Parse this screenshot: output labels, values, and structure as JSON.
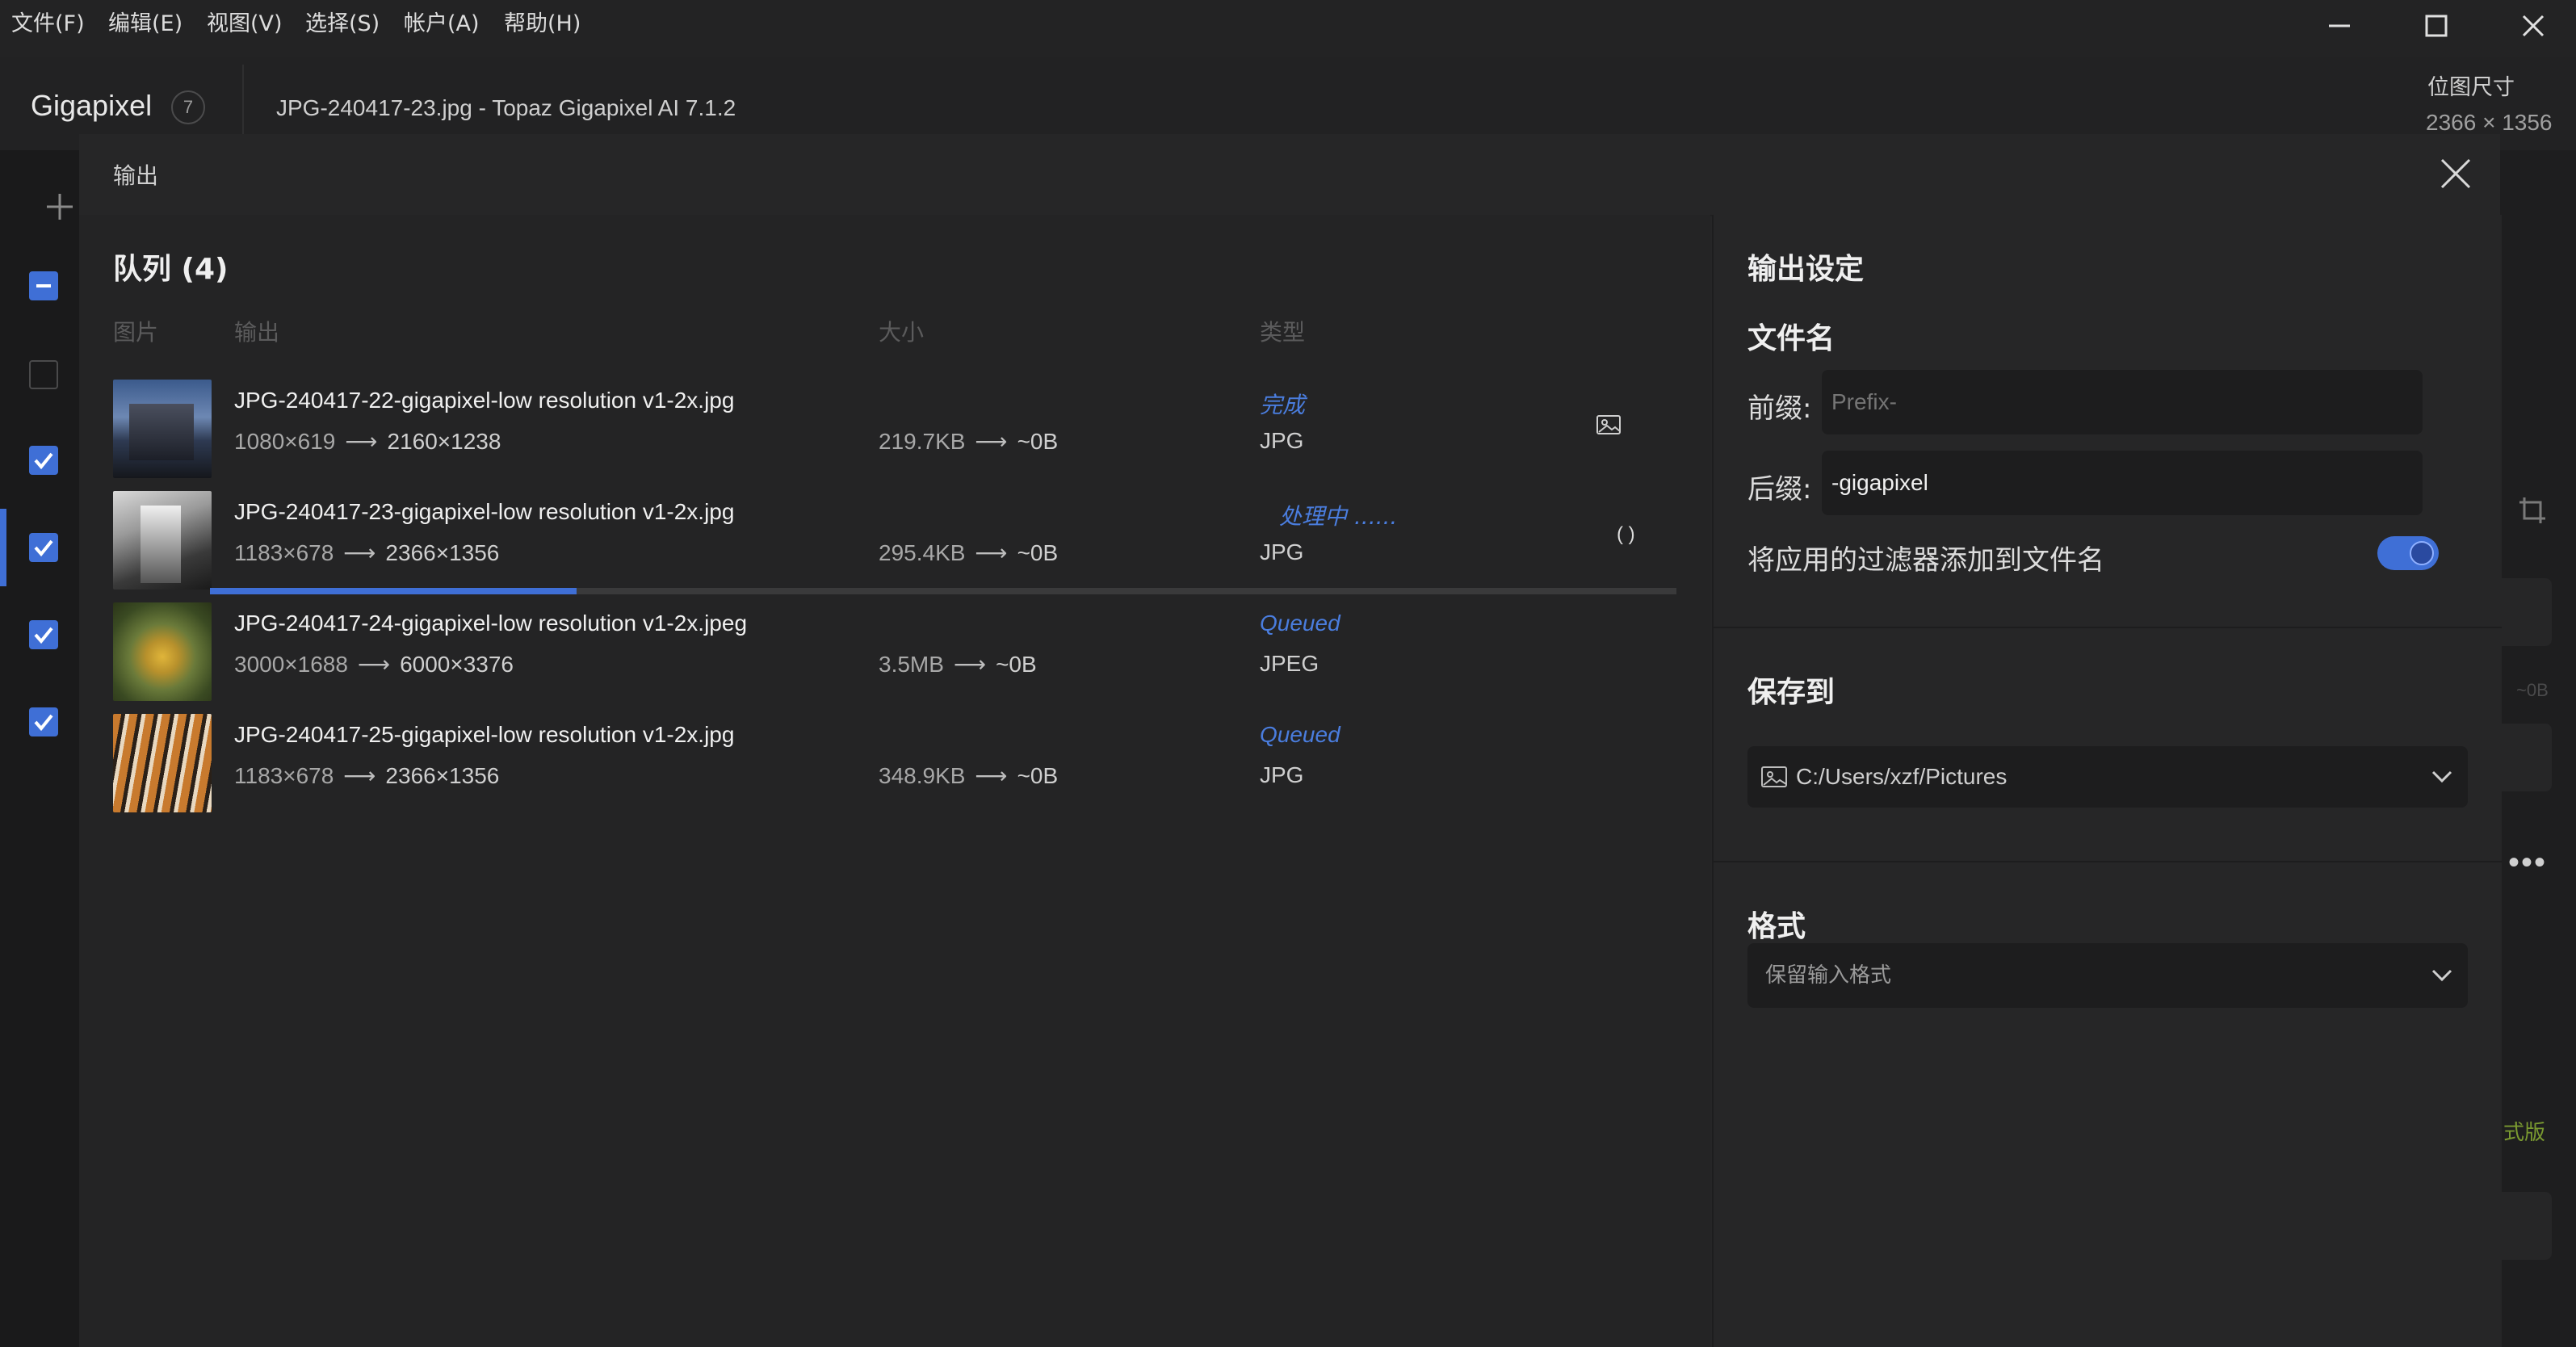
{
  "menu": {
    "items": [
      "文件(F)",
      "编辑(E)",
      "视图(V)",
      "选择(S)",
      "帐户(A)",
      "帮助(H)"
    ]
  },
  "app": {
    "name": "Gigapixel",
    "badge": "7",
    "window_title": "JPG-240417-23.jpg - Topaz Gigapixel AI 7.1.2",
    "bitmap_label": "位图尺寸",
    "bitmap_value": "2366 × 1356"
  },
  "dialog": {
    "title": "输出",
    "queue_title": "队列 (4)",
    "columns": [
      "图片",
      "输出",
      "大小",
      "类型"
    ],
    "rows": [
      {
        "filename": "JPG-240417-22-gigapixel-low resolution v1-2x.jpg",
        "dim_from": "1080×619",
        "dim_to": "2160×1238",
        "size_from": "219.7KB",
        "size_to": "~0B",
        "status": "完成",
        "type": "JPG",
        "action_icon": "folder-image-icon"
      },
      {
        "filename": "JPG-240417-23-gigapixel-low resolution v1-2x.jpg",
        "dim_from": "1183×678",
        "dim_to": "2366×1356",
        "size_from": "295.4KB",
        "size_to": "~0B",
        "status": "处理中 ......",
        "type": "JPG",
        "action_icon": "spinner-icon",
        "progress": 0.25
      },
      {
        "filename": "JPG-240417-24-gigapixel-low resolution v1-2x.jpeg",
        "dim_from": "3000×1688",
        "dim_to": "6000×3376",
        "size_from": "3.5MB",
        "size_to": "~0B",
        "status": "Queued",
        "type": "JPEG"
      },
      {
        "filename": "JPG-240417-25-gigapixel-low resolution v1-2x.jpg",
        "dim_from": "1183×678",
        "dim_to": "2366×1356",
        "size_from": "348.9KB",
        "size_to": "~0B",
        "status": "Queued",
        "type": "JPG"
      }
    ]
  },
  "settings": {
    "title": "输出设定",
    "filename_title": "文件名",
    "prefix_label": "前缀:",
    "prefix_placeholder": "Prefix-",
    "suffix_label": "后缀:",
    "suffix_value": "-gigapixel",
    "filter_toggle_label": "将应用的过滤器添加到文件名",
    "filter_toggle_on": true,
    "save_title": "保存到",
    "save_path": "C:/Users/xzf/Pictures",
    "format_title": "格式",
    "format_value": "保留输入格式"
  },
  "background": {
    "size_hint": "~0B",
    "trial_text": "式版"
  },
  "colors": {
    "accent": "#3f6fd6",
    "status_blue": "#4a7dde"
  }
}
